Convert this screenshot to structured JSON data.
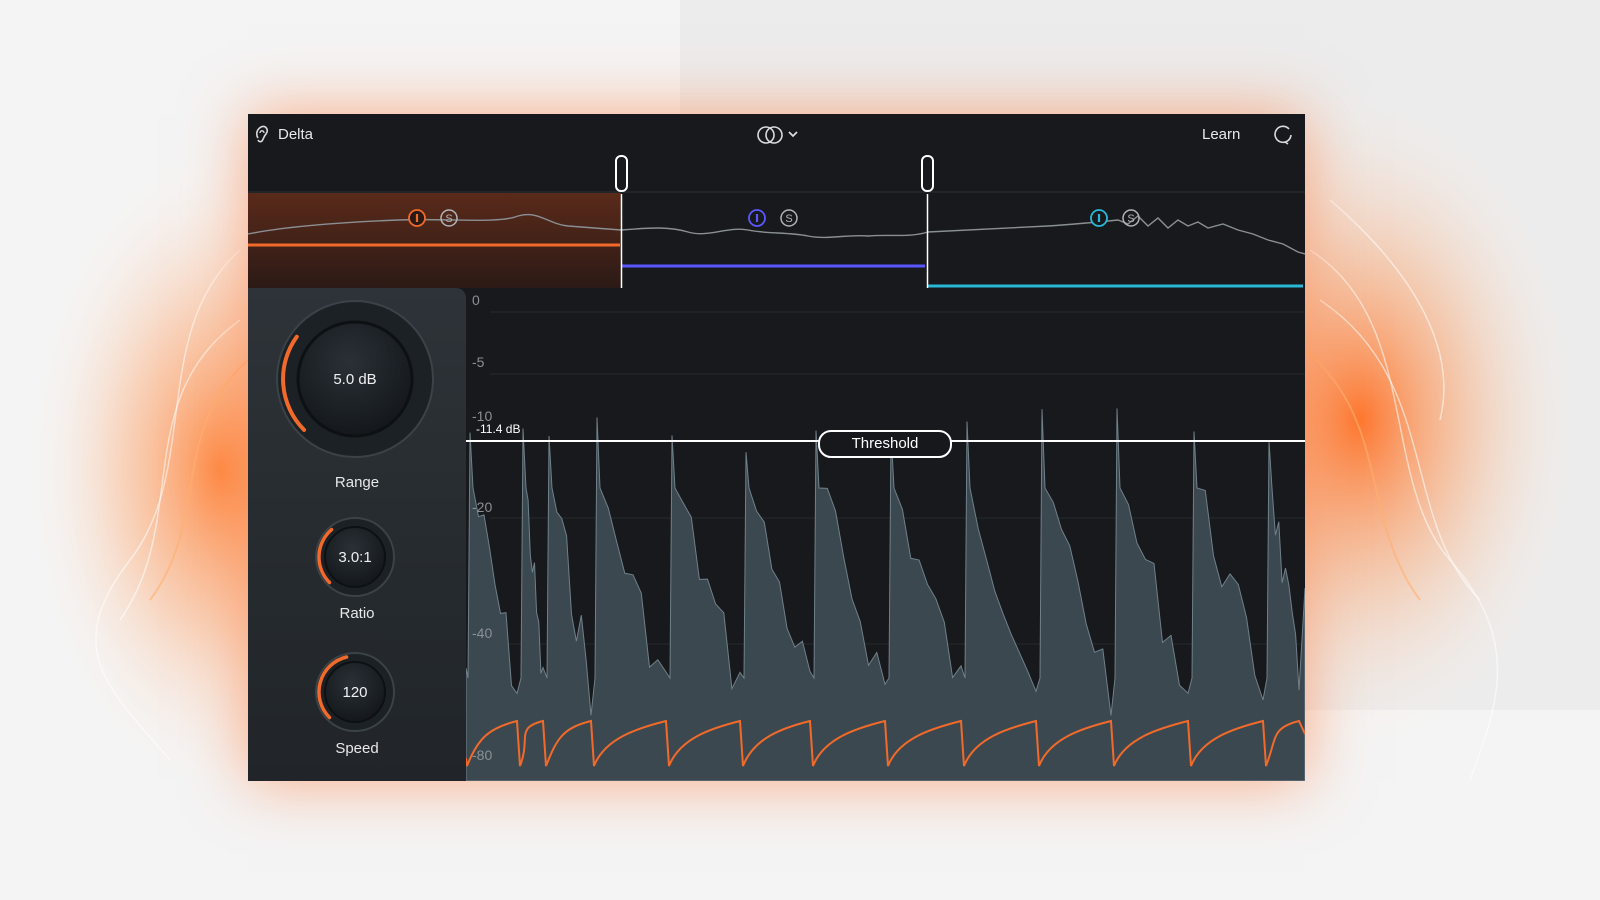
{
  "app": {
    "title": "Delta",
    "learn_label": "Learn"
  },
  "icons": {
    "ear": "ear-icon",
    "link": "stereo-link-icon",
    "dropdown": "chevron-down-icon",
    "reset": "refresh-icon",
    "mute": "mute-toggle-icon",
    "solo": "solo-icon"
  },
  "colors": {
    "accent_orange": "#f26a2a",
    "band_mid": "#5b57ff",
    "band_high": "#29b8d6",
    "waveform": "#3b4850"
  },
  "bands": [
    {
      "name": "low",
      "color": "#f26a2a",
      "solo_label": "S",
      "active": true
    },
    {
      "name": "mid",
      "color": "#5b57ff",
      "solo_label": "S",
      "active": false
    },
    {
      "name": "high",
      "color": "#29b8d6",
      "solo_label": "S",
      "active": false
    }
  ],
  "controls": {
    "range": {
      "label": "Range",
      "value": "5.0 dB",
      "level": 0.3
    },
    "ratio": {
      "label": "Ratio",
      "value": "3.0:1",
      "level": 0.35
    },
    "speed": {
      "label": "Speed",
      "value": "120",
      "level": 0.45
    }
  },
  "meter": {
    "axis_labels": [
      "0",
      "-5",
      "-10",
      "-20",
      "-40",
      "-80"
    ],
    "threshold_label": "Threshold",
    "threshold_value": "-11.4 dB"
  }
}
